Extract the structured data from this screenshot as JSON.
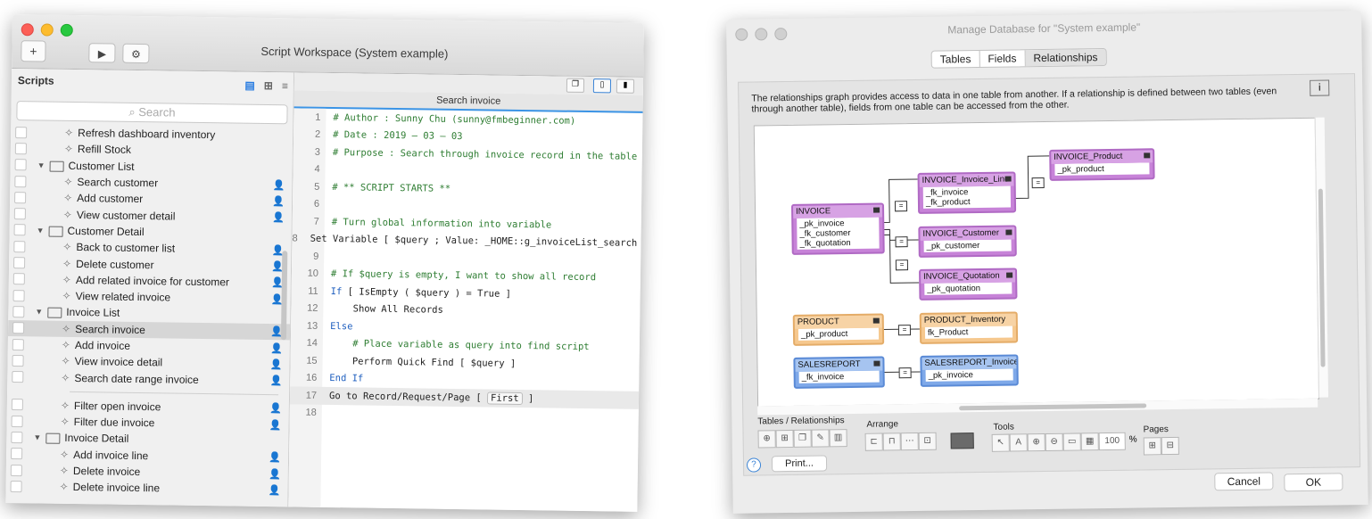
{
  "script_workspace": {
    "title": "Script Workspace (System example)",
    "toolbar": {
      "new_label": "+",
      "run_label": "▶",
      "debug_label": "⚙"
    },
    "sidebar": {
      "heading": "Scripts",
      "search_placeholder": "Search",
      "rows": [
        {
          "type": "script",
          "label": "Refresh dashboard inventory",
          "user": false
        },
        {
          "type": "script",
          "label": "Refill Stock",
          "user": false
        },
        {
          "type": "folder",
          "label": "Customer List"
        },
        {
          "type": "script",
          "label": "Search customer",
          "user": true
        },
        {
          "type": "script",
          "label": "Add customer",
          "user": true
        },
        {
          "type": "script",
          "label": "View customer detail",
          "user": true
        },
        {
          "type": "folder",
          "label": "Customer Detail"
        },
        {
          "type": "script",
          "label": "Back to customer list",
          "user": true
        },
        {
          "type": "script",
          "label": "Delete customer",
          "user": true
        },
        {
          "type": "script",
          "label": "Add related invoice for customer",
          "user": true
        },
        {
          "type": "script",
          "label": "View related invoice",
          "user": true
        },
        {
          "type": "folder",
          "label": "Invoice List"
        },
        {
          "type": "script",
          "label": "Search invoice",
          "user": true,
          "selected": true
        },
        {
          "type": "script",
          "label": "Add invoice",
          "user": true
        },
        {
          "type": "script",
          "label": "View invoice detail",
          "user": true
        },
        {
          "type": "script",
          "label": "Search date range invoice",
          "user": true
        },
        {
          "type": "divider"
        },
        {
          "type": "script",
          "label": "Filter open invoice",
          "user": true
        },
        {
          "type": "script",
          "label": "Filter due invoice",
          "user": true
        },
        {
          "type": "folder",
          "label": "Invoice Detail"
        },
        {
          "type": "script",
          "label": "Add invoice line",
          "user": true
        },
        {
          "type": "script",
          "label": "Delete invoice",
          "user": true
        },
        {
          "type": "script",
          "label": "Delete invoice line",
          "user": true
        }
      ]
    },
    "editor": {
      "tab_title": "Search invoice",
      "lines": [
        {
          "n": "1",
          "html": "<span class='cmt'># Author : Sunny Chu (sunny@fmbeginner.com)</span>"
        },
        {
          "n": "2",
          "html": "<span class='cmt'># Date : 2019 – 03 – 03</span>"
        },
        {
          "n": "3",
          "html": "<span class='cmt'># Purpose : Search through invoice record in the table</span>"
        },
        {
          "n": "4",
          "html": ""
        },
        {
          "n": "5",
          "html": "<span class='cmt'># ** SCRIPT STARTS **</span>"
        },
        {
          "n": "6",
          "html": ""
        },
        {
          "n": "7",
          "html": "<span class='cmt'># Turn global information into variable</span>"
        },
        {
          "n": "8",
          "html": "Set Variable [ $query ; Value: _HOME::g_invoiceList_search ]"
        },
        {
          "n": "9",
          "html": ""
        },
        {
          "n": "10",
          "html": "<span class='cmt'># If $query is empty, I want to show all record</span>"
        },
        {
          "n": "11",
          "html": "<span class='kw'>If</span> [ IsEmpty ( $query ) = True ]"
        },
        {
          "n": "12",
          "html": "    Show All Records"
        },
        {
          "n": "13",
          "html": "<span class='kw'>Else</span>"
        },
        {
          "n": "14",
          "html": "    <span class='cmt'># Place variable as query into find script</span>"
        },
        {
          "n": "15",
          "html": "    Perform Quick Find [ $query ]"
        },
        {
          "n": "16",
          "html": "<span class='kw'>End If</span>"
        },
        {
          "n": "17",
          "html": "Go to Record/Request/Page [ <span class='pill'>First</span> ]",
          "hl": true
        },
        {
          "n": "18",
          "html": ""
        }
      ]
    }
  },
  "manage_db": {
    "title": "Manage Database for \"System example\"",
    "tabs": [
      "Tables",
      "Fields",
      "Relationships"
    ],
    "active_tab": "Relationships",
    "description": "The relationships graph provides access to data in one table from another. If a relationship is defined between two tables (even through another table), fields from one table can be accessed from the other.",
    "tables": {
      "invoice": {
        "name": "INVOICE",
        "fields": [
          "_pk_invoice",
          "_fk_customer",
          "_fk_quotation"
        ]
      },
      "invoice_line": {
        "name": "INVOICE_Invoice_Line",
        "fields": [
          "_fk_invoice",
          "_fk_product"
        ]
      },
      "invoice_product": {
        "name": "INVOICE_Product",
        "fields": [
          "_pk_product"
        ]
      },
      "invoice_customer": {
        "name": "INVOICE_Customer",
        "fields": [
          "_pk_customer"
        ]
      },
      "invoice_quotation": {
        "name": "INVOICE_Quotation",
        "fields": [
          "_pk_quotation"
        ]
      },
      "product": {
        "name": "PRODUCT",
        "fields": [
          "_pk_product"
        ]
      },
      "product_inventory": {
        "name": "PRODUCT_Inventory",
        "fields": [
          "fk_Product"
        ]
      },
      "salesreport": {
        "name": "SALESREPORT",
        "fields": [
          "_fk_invoice"
        ]
      },
      "salesreport_invoice": {
        "name": "SALESREPORT_Invoice",
        "fields": [
          "_pk_invoice"
        ]
      }
    },
    "toolbar": {
      "tables_label": "Tables / Relationships",
      "arrange_label": "Arrange",
      "tools_label": "Tools",
      "pages_label": "Pages",
      "zoom": "100",
      "zoom_unit": "%"
    },
    "footer": {
      "help": "?",
      "print": "Print...",
      "cancel": "Cancel",
      "ok": "OK"
    },
    "colors": {
      "purple": "#c783d8",
      "orange": "#f6c88e",
      "blue": "#7fa9e9"
    }
  }
}
